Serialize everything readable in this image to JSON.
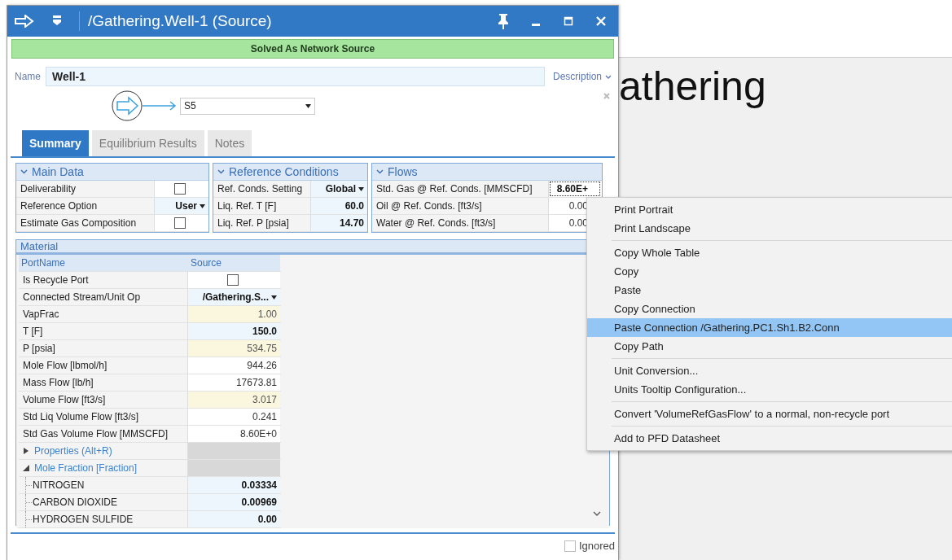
{
  "window": {
    "title": "/Gathering.Well-1 (Source)"
  },
  "status": "Solved As Network Source",
  "name": {
    "label": "Name",
    "value": "Well-1"
  },
  "description": "Description",
  "stream": {
    "value": "S5"
  },
  "tabs": [
    {
      "label": "Summary",
      "selected": true
    },
    {
      "label": "Equilibrium Results",
      "selected": false
    },
    {
      "label": "Notes",
      "selected": false
    }
  ],
  "panels": [
    {
      "title": "Main Data",
      "rows": [
        {
          "label": "Deliverability",
          "kind": "checkbox",
          "checked": false
        },
        {
          "label": "Reference Option",
          "kind": "dropdown",
          "value": "User"
        },
        {
          "label": "Estimate Gas Composition",
          "kind": "checkbox",
          "checked": false
        }
      ]
    },
    {
      "title": "Reference Conditions",
      "rows": [
        {
          "label": "Ref. Conds. Setting",
          "kind": "dropdown",
          "value": "Global"
        },
        {
          "label": "Liq. Ref. T [F]",
          "kind": "input",
          "value": "60.0"
        },
        {
          "label": "Liq. Ref. P [psia]",
          "kind": "input",
          "value": "14.70"
        }
      ]
    },
    {
      "title": "Flows",
      "rows": [
        {
          "label": "Std. Gas @ Ref. Conds. [MMSCFD]",
          "kind": "focused",
          "value": "8.60E+"
        },
        {
          "label": "Oil @ Ref. Conds. [ft3/s]",
          "kind": "plain",
          "value": "0.00"
        },
        {
          "label": "Water @ Ref. Conds. [ft3/s]",
          "kind": "plain",
          "value": "0.00"
        }
      ]
    }
  ],
  "material": {
    "title": "Material",
    "columns": [
      "PortName",
      "Source"
    ],
    "rows": [
      {
        "label": "Is Recycle Port",
        "kind": "checkbox",
        "checked": false
      },
      {
        "label": "Connected Stream/Unit Op",
        "kind": "dropdown",
        "value": "/Gathering.S..."
      },
      {
        "label": "VapFrac",
        "kind": "calculated",
        "value": "1.00"
      },
      {
        "label": "T [F]",
        "kind": "input",
        "value": "150.0"
      },
      {
        "label": "P [psia]",
        "kind": "calculated",
        "value": "534.75"
      },
      {
        "label": "Mole Flow [lbmol/h]",
        "kind": "plain",
        "value": "944.26"
      },
      {
        "label": "Mass Flow [lb/h]",
        "kind": "plain",
        "value": "17673.81"
      },
      {
        "label": "Volume Flow [ft3/s]",
        "kind": "calculated",
        "value": "3.017"
      },
      {
        "label": "Std Liq Volume Flow [ft3/s]",
        "kind": "plain",
        "value": "0.241"
      },
      {
        "label": "Std Gas Volume Flow [MMSCFD]",
        "kind": "plain",
        "value": "8.60E+0"
      },
      {
        "label": "Properties  (Alt+R)",
        "kind": "group",
        "expanded": false
      },
      {
        "label": "Mole Fraction [Fraction]",
        "kind": "group",
        "expanded": true
      },
      {
        "label": "NITROGEN",
        "kind": "component",
        "value": "0.03334"
      },
      {
        "label": "CARBON DIOXIDE",
        "kind": "component",
        "value": "0.00969"
      },
      {
        "label": "HYDROGEN SULFIDE",
        "kind": "component",
        "value": "0.00"
      }
    ]
  },
  "ignored": {
    "label": "Ignored",
    "checked": false
  },
  "canvas": {
    "title": "athering"
  },
  "context_menu": {
    "groups": [
      [
        {
          "label": "Print Portrait",
          "selected": false
        },
        {
          "label": "Print Landscape",
          "selected": false
        }
      ],
      [
        {
          "label": "Copy Whole Table",
          "selected": false
        },
        {
          "label": "Copy",
          "selected": false
        },
        {
          "label": "Paste",
          "selected": false
        },
        {
          "label": "Copy Connection",
          "selected": false
        },
        {
          "label": "Paste Connection /Gathering.PC1.Sh1.B2.Conn",
          "selected": true
        },
        {
          "label": "Copy Path",
          "selected": false
        }
      ],
      [
        {
          "label": "Unit Conversion...",
          "selected": false
        },
        {
          "label": "Units Tooltip Configuration...",
          "selected": false
        }
      ],
      [
        {
          "label": "Convert 'VolumeRefGasFlow' to a normal, non-recycle port",
          "selected": false
        }
      ],
      [
        {
          "label": "Add to PFD Datasheet",
          "selected": false
        }
      ]
    ]
  }
}
